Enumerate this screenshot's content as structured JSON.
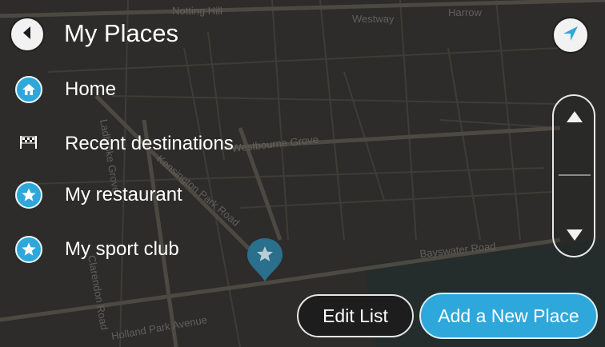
{
  "header": {
    "title": "My Places"
  },
  "map": {
    "labels": [
      "Notting Hill",
      "Westway",
      "Harrow",
      "Westbourne Grove",
      "Ladbroke Grove",
      "Kensington Park Road",
      "Bayswater Road",
      "Clarendon Road",
      "Holland Park Avenue"
    ]
  },
  "places": {
    "items": [
      {
        "label": "Home",
        "icon": "home-icon"
      },
      {
        "label": "Recent destinations",
        "icon": "checkered-flag-icon"
      },
      {
        "label": "My restaurant",
        "icon": "star-icon"
      },
      {
        "label": "My sport club",
        "icon": "star-icon"
      }
    ]
  },
  "actions": {
    "edit_label": "Edit List",
    "add_label": "Add a New Place"
  },
  "colors": {
    "accent": "#2ea7db",
    "background": "#3a3937",
    "button_light": "#f2f2f2"
  }
}
